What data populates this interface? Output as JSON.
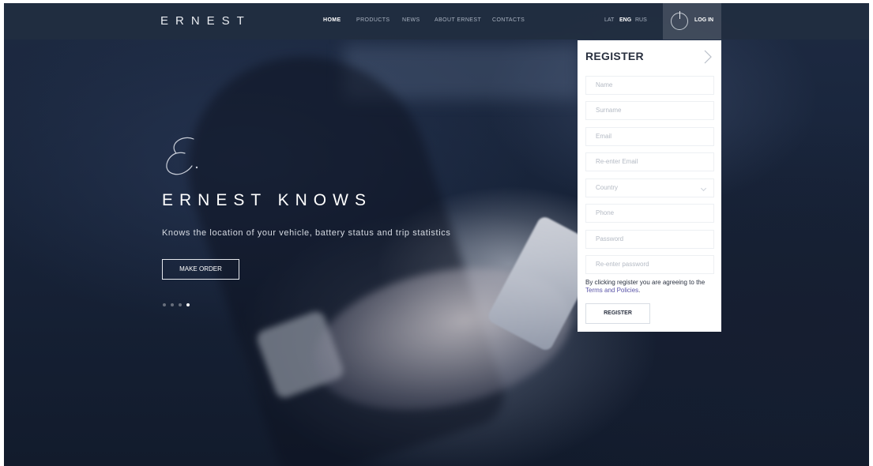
{
  "brand": {
    "logo": "ERNEST"
  },
  "nav": {
    "links": [
      "HOME",
      "PRODUCTS",
      "NEWS",
      "ABOUT ERNEST",
      "CONTACTS"
    ],
    "active_link": "HOME",
    "languages": [
      "LAT",
      "ENG",
      "RUS"
    ],
    "active_language": "ENG",
    "login_label": "LOG IN"
  },
  "hero": {
    "script_mark": "E.",
    "title": "ERNEST KNOWS",
    "subtitle": "Knows the location of your vehicle, battery status and trip statistics",
    "cta_label": "MAKE ORDER",
    "slider": {
      "total": 4,
      "active_index": 3
    }
  },
  "register": {
    "title": "REGISTER",
    "fields": {
      "name": "Name",
      "surname": "Surname",
      "email": "Email",
      "reenter_email": "Re-enter Email",
      "country": "Country",
      "phone": "Phone",
      "password": "Password",
      "reenter_password": "Re-enter password"
    },
    "terms_text": "By clicking register you are agreeing to the ",
    "terms_link": "Terms and Policies",
    "terms_end": ".",
    "submit_label": "REGISTER"
  },
  "colors": {
    "nav_bg": "#212e40",
    "hero_bg": "#18243a",
    "panel_bg": "#ffffff",
    "link_accent": "#5a54a8",
    "text_dark": "#2a3140"
  }
}
